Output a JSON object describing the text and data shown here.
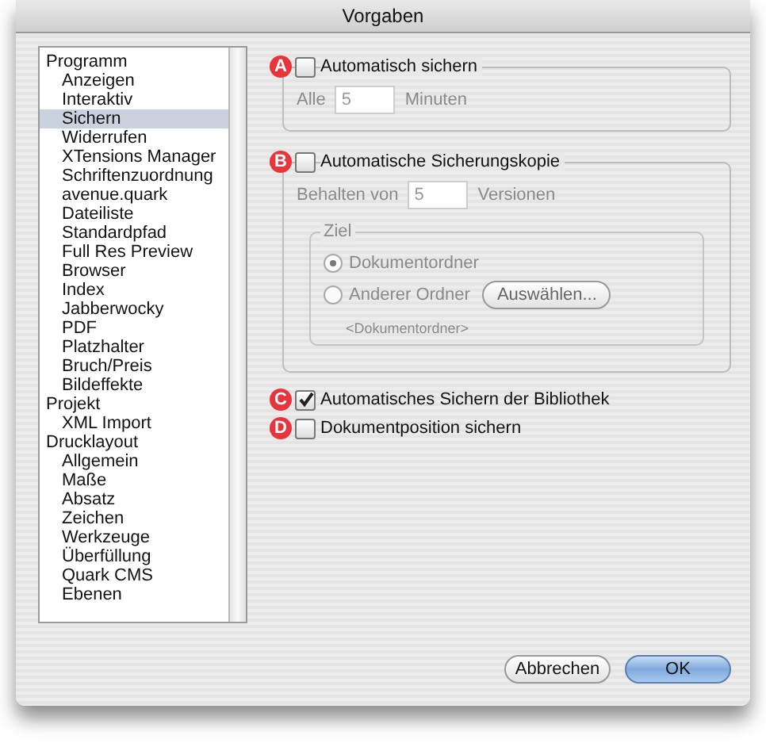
{
  "window": {
    "title": "Vorgaben"
  },
  "sidebar": {
    "items": [
      {
        "label": "Programm",
        "selected": false,
        "children": [
          {
            "label": "Anzeigen",
            "selected": false
          },
          {
            "label": "Interaktiv",
            "selected": false
          },
          {
            "label": "Sichern",
            "selected": true
          },
          {
            "label": "Widerrufen",
            "selected": false
          },
          {
            "label": "XTensions Manager",
            "selected": false
          },
          {
            "label": "Schriftenzuordnung",
            "selected": false
          },
          {
            "label": "avenue.quark",
            "selected": false
          },
          {
            "label": "Dateiliste",
            "selected": false
          },
          {
            "label": "Standardpfad",
            "selected": false
          },
          {
            "label": "Full Res Preview",
            "selected": false
          },
          {
            "label": "Browser",
            "selected": false
          },
          {
            "label": "Index",
            "selected": false
          },
          {
            "label": "Jabberwocky",
            "selected": false
          },
          {
            "label": "PDF",
            "selected": false
          },
          {
            "label": "Platzhalter",
            "selected": false
          },
          {
            "label": "Bruch/Preis",
            "selected": false
          },
          {
            "label": "Bildeffekte",
            "selected": false
          }
        ]
      },
      {
        "label": "Projekt",
        "selected": false,
        "children": [
          {
            "label": "XML Import",
            "selected": false
          }
        ]
      },
      {
        "label": "Drucklayout",
        "selected": false,
        "children": [
          {
            "label": "Allgemein",
            "selected": false
          },
          {
            "label": "Maße",
            "selected": false
          },
          {
            "label": "Absatz",
            "selected": false
          },
          {
            "label": "Zeichen",
            "selected": false
          },
          {
            "label": "Werkzeuge",
            "selected": false
          },
          {
            "label": "Überfüllung",
            "selected": false
          },
          {
            "label": "Quark CMS",
            "selected": false
          },
          {
            "label": "Ebenen",
            "selected": false
          }
        ]
      }
    ]
  },
  "sections": [
    {
      "marker": "A",
      "label": "Automatisch sichern",
      "checked": false,
      "field": {
        "prefix": "Alle",
        "value": "5",
        "suffix": "Minuten",
        "disabled": true
      }
    },
    {
      "marker": "B",
      "label": "Automatische Sicherungskopie",
      "checked": false,
      "field": {
        "prefix": "Behalten von",
        "value": "5",
        "suffix": "Versionen",
        "disabled": true
      },
      "destination": {
        "title": "Ziel",
        "disabled": true,
        "options": [
          {
            "label": "Dokumentordner",
            "selected": true
          },
          {
            "label": "Anderer Ordner",
            "selected": false
          }
        ],
        "choose_button": "Auswählen...",
        "path": "<Dokumentordner>"
      }
    }
  ],
  "checkboxes": [
    {
      "marker": "C",
      "label": "Automatisches Sichern der Bibliothek",
      "checked": true
    },
    {
      "marker": "D",
      "label": "Dokumentposition sichern",
      "checked": false
    }
  ],
  "buttons": [
    {
      "label": "Abbrechen",
      "kind": "secondary"
    },
    {
      "label": "OK",
      "kind": "default"
    }
  ]
}
